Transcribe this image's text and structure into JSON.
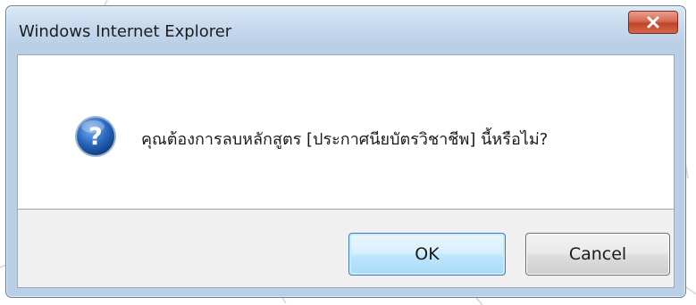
{
  "window": {
    "title": "Windows Internet Explorer",
    "close_icon": "close-icon"
  },
  "dialog": {
    "icon": "question-icon",
    "message": "คุณต้องการลบหลักสูตร [ประกาศนียบัตรวิชาชีพ] นี้หรือไม่?"
  },
  "buttons": {
    "ok_label": "OK",
    "cancel_label": "Cancel"
  },
  "colors": {
    "close_button": "#c1442a",
    "ok_border": "#3c7fb1",
    "question_icon": "#1f5aa8"
  }
}
